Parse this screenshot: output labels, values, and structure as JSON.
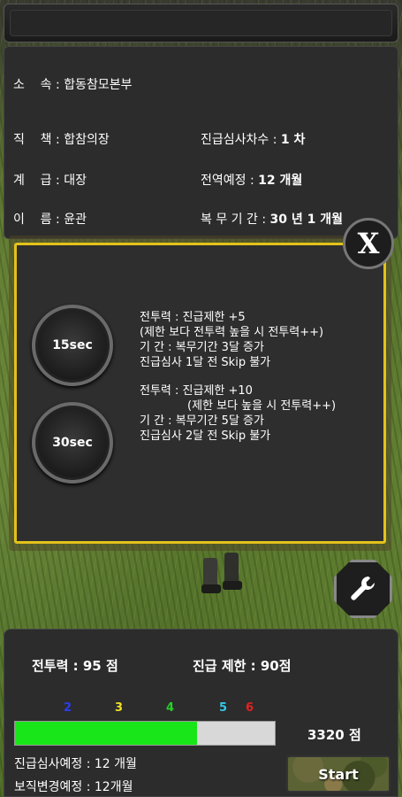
{
  "info": {
    "affiliation_label": "소    속 :",
    "affiliation_value": "합동참모본부",
    "position_label": "직    책 :",
    "position_value": "합참의장",
    "review_round_label": "진급심사차수 :",
    "review_round_value": "1 차",
    "rank_label": "계    급 :",
    "rank_value": "대장",
    "discharge_label": "전역예정 :",
    "discharge_value": "12 개월",
    "name_label": "이    름 :",
    "name_value": "윤관",
    "service_label": "복 무 기 간 :",
    "service_value": "30 년 1 개월"
  },
  "overlay": {
    "close_label": "X",
    "option1": {
      "button": "15sec",
      "line1": "전투력 : 진급제한 +5",
      "line2": "(제한 보다 전투력 높을 시 전투력++)",
      "line3": "기   간 : 복무기간 3달 증가",
      "line4": "진급심사 1달 전 Skip 불가"
    },
    "option2": {
      "button": "30sec",
      "line1": "전투력 : 진급제한 +10",
      "line2": "(제한 보다 높을 시 전투력++)",
      "line3": "기   간 : 복무기간 5달 증가",
      "line4": "진급심사 2달 전 Skip 불가"
    }
  },
  "status": {
    "combat_power": "전투력 : 95 점",
    "promotion_limit": "진급 제한 :  90점",
    "markers": [
      "2",
      "3",
      "4",
      "5",
      "6"
    ],
    "marker_colors": [
      "#2a3cf0",
      "#f0e020",
      "#22d422",
      "#35c8e8",
      "#e82020"
    ],
    "progress": 0.7,
    "score": "3320 점",
    "review_schedule": "진급심사예정 : 12 개월",
    "assignment_change": "보직변경예정 : 12개월",
    "start_label": "Start"
  }
}
